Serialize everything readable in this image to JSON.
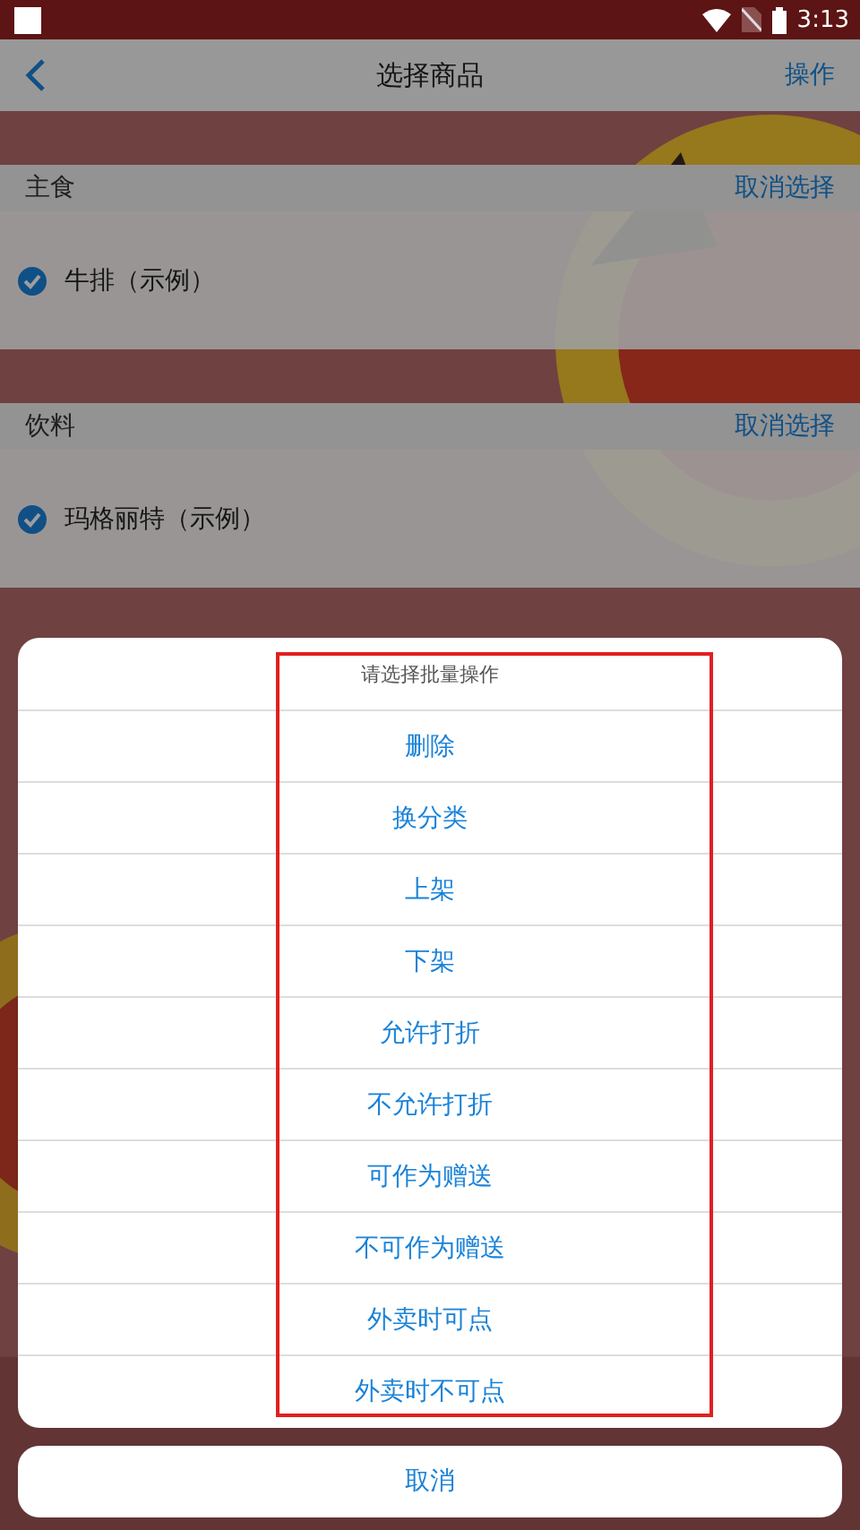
{
  "status_bar": {
    "time": "3:13"
  },
  "header": {
    "title": "选择商品",
    "action": "操作"
  },
  "sections": [
    {
      "title": "主食",
      "action": "取消选择",
      "items": [
        {
          "name": "牛排（示例）",
          "checked": true
        }
      ]
    },
    {
      "title": "饮料",
      "action": "取消选择",
      "items": [
        {
          "name": "玛格丽特（示例）",
          "checked": true
        }
      ]
    }
  ],
  "action_sheet": {
    "title": "请选择批量操作",
    "options": [
      "删除",
      "换分类",
      "上架",
      "下架",
      "允许打折",
      "不允许打折",
      "可作为赠送",
      "不可作为赠送",
      "外卖时可点",
      "外卖时不可点"
    ],
    "cancel": "取消"
  }
}
